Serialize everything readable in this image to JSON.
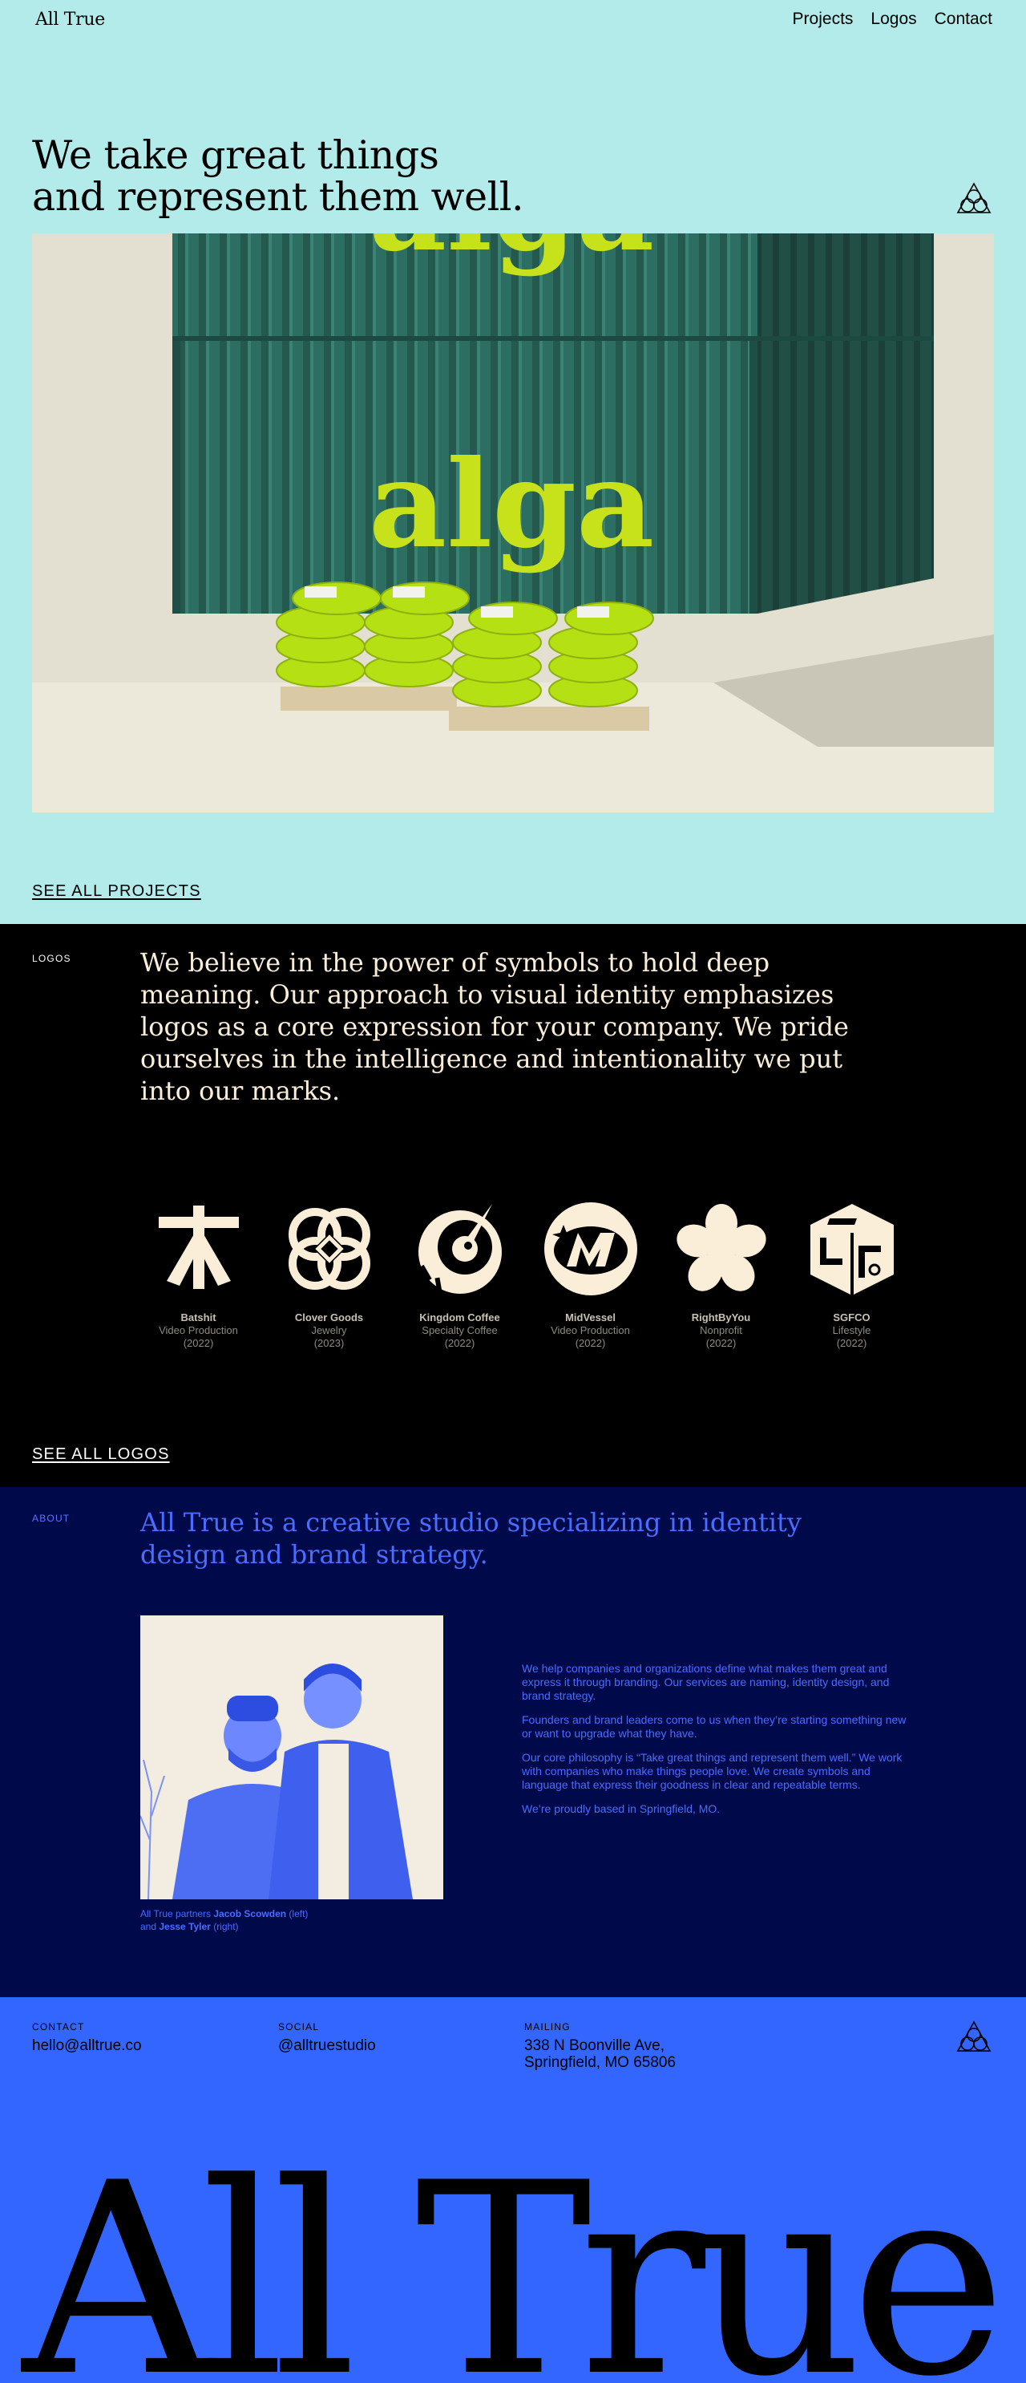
{
  "nav": {
    "brand": "All True",
    "links": [
      "Projects",
      "Logos",
      "Contact"
    ]
  },
  "hero": {
    "headline_line1": "We take great things",
    "headline_line2": "and represent them well.",
    "image_text": "alga",
    "see_all": "SEE ALL PROJECTS"
  },
  "logos_section": {
    "label": "LOGOS",
    "intro": "We believe in the power of symbols to hold deep meaning. Our approach to visual identity emphasizes logos as a core expression for your company. We pride ourselves in the intelligence and intentionality we put into our marks.",
    "items": [
      {
        "name": "Batshit",
        "category": "Video Production",
        "year": "(2022)",
        "icon": "batshit-logo-icon"
      },
      {
        "name": "Clover Goods",
        "category": "Jewelry",
        "year": "(2023)",
        "icon": "clover-goods-logo-icon"
      },
      {
        "name": "Kingdom Coffee",
        "category": "Specialty Coffee",
        "year": "(2022)",
        "icon": "kingdom-coffee-logo-icon"
      },
      {
        "name": "MidVessel",
        "category": "Video Production",
        "year": "(2022)",
        "icon": "midvessel-logo-icon"
      },
      {
        "name": "RightByYou",
        "category": "Nonprofit",
        "year": "(2022)",
        "icon": "rightbyyou-logo-icon"
      },
      {
        "name": "SGFCO",
        "category": "Lifestyle",
        "year": "(2022)",
        "icon": "sgfco-logo-icon"
      }
    ],
    "see_all": "SEE ALL LOGOS"
  },
  "about": {
    "label": "ABOUT",
    "intro": "All True is a creative studio specializing in identity design and brand strategy.",
    "caption": {
      "prefix": "All True partners ",
      "name1": "Jacob Scowden",
      "mid": " (left)",
      "and": "and ",
      "name2": "Jesse Tyler",
      "suffix": " (right)"
    },
    "paragraphs": [
      "We help companies and organizations define what makes them great and express it through branding. Our services are naming, identity design, and brand strategy.",
      "Founders and brand leaders come to us when they’re starting something new or want to upgrade what they have.",
      "Our core philosophy is “Take great things and represent them well.” We work with companies who make things people love. We create symbols and language that express their goodness in clear and repeatable terms.",
      "We’re proudly based in Springfield, MO."
    ]
  },
  "footer": {
    "contact": {
      "label": "CONTACT",
      "value": "hello@alltrue.co"
    },
    "social": {
      "label": "SOCIAL",
      "value": "@alltruestudio"
    },
    "mailing": {
      "label": "MAILING",
      "line1": "338 N Boonville Ave,",
      "line2": "Springfield, MO 65806"
    },
    "bigword": "All True"
  },
  "colors": {
    "hero_bg": "#b3ebeb",
    "logos_bg": "#000000",
    "logo_cream": "#fbeed9",
    "about_bg": "#000a4a",
    "about_accent": "#4a6cff",
    "footer_bg": "#3366ff",
    "container_green": "#2c6e62",
    "alga_lime": "#c7e21a"
  }
}
